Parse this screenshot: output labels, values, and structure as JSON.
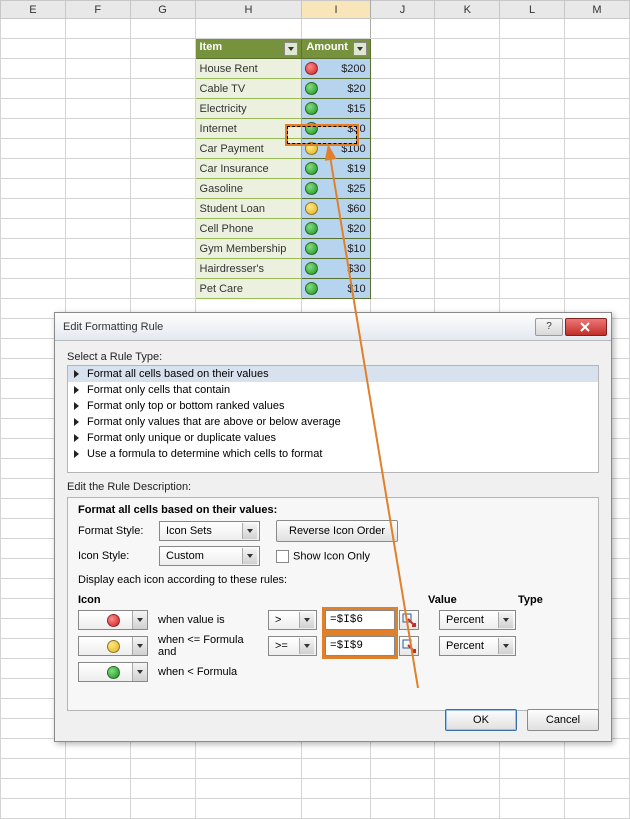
{
  "columns": [
    "E",
    "F",
    "G",
    "H",
    "I",
    "J",
    "K",
    "L",
    "M"
  ],
  "table": {
    "headers": {
      "item": "Item",
      "amount": "Amount"
    },
    "rows": [
      {
        "item": "House Rent",
        "amount": "$200",
        "icon": "red"
      },
      {
        "item": "Cable TV",
        "amount": "$20",
        "icon": "green"
      },
      {
        "item": "Electricity",
        "amount": "$15",
        "icon": "green"
      },
      {
        "item": "Internet",
        "amount": "$30",
        "icon": "green"
      },
      {
        "item": "Car Payment",
        "amount": "$100",
        "icon": "yellow"
      },
      {
        "item": "Car Insurance",
        "amount": "$19",
        "icon": "green"
      },
      {
        "item": "Gasoline",
        "amount": "$25",
        "icon": "green"
      },
      {
        "item": "Student Loan",
        "amount": "$60",
        "icon": "yellow"
      },
      {
        "item": "Cell Phone",
        "amount": "$20",
        "icon": "green"
      },
      {
        "item": "Gym Membership",
        "amount": "$10",
        "icon": "green"
      },
      {
        "item": "Hairdresser's",
        "amount": "$30",
        "icon": "green"
      },
      {
        "item": "Pet Care",
        "amount": "$10",
        "icon": "green"
      }
    ]
  },
  "dialog": {
    "title": "Edit Formatting Rule",
    "sect_type": "Select a Rule Type:",
    "rule_types": [
      "Format all cells based on their values",
      "Format only cells that contain",
      "Format only top or bottom ranked values",
      "Format only values that are above or below average",
      "Format only unique or duplicate values",
      "Use a formula to determine which cells to format"
    ],
    "sect_desc": "Edit the Rule Description:",
    "desc_heading": "Format all cells based on their values:",
    "format_style_label": "Format Style:",
    "format_style_value": "Icon Sets",
    "reverse_label": "Reverse Icon Order",
    "icon_style_label": "Icon Style:",
    "icon_style_value": "Custom",
    "show_icon_only": "Show Icon Only",
    "display_text": "Display each icon according to these rules:",
    "hdr_icon": "Icon",
    "hdr_value": "Value",
    "hdr_type": "Type",
    "rule_rows": [
      {
        "icon": "red",
        "text": "when value is",
        "op": ">",
        "value": "=$I$6",
        "type": "Percent"
      },
      {
        "icon": "yellow",
        "text": "when <= Formula and",
        "op": ">=",
        "value": "=$I$9",
        "type": "Percent"
      },
      {
        "icon": "green",
        "text": "when < Formula",
        "op": "",
        "value": "",
        "type": ""
      }
    ],
    "ok": "OK",
    "cancel": "Cancel"
  }
}
